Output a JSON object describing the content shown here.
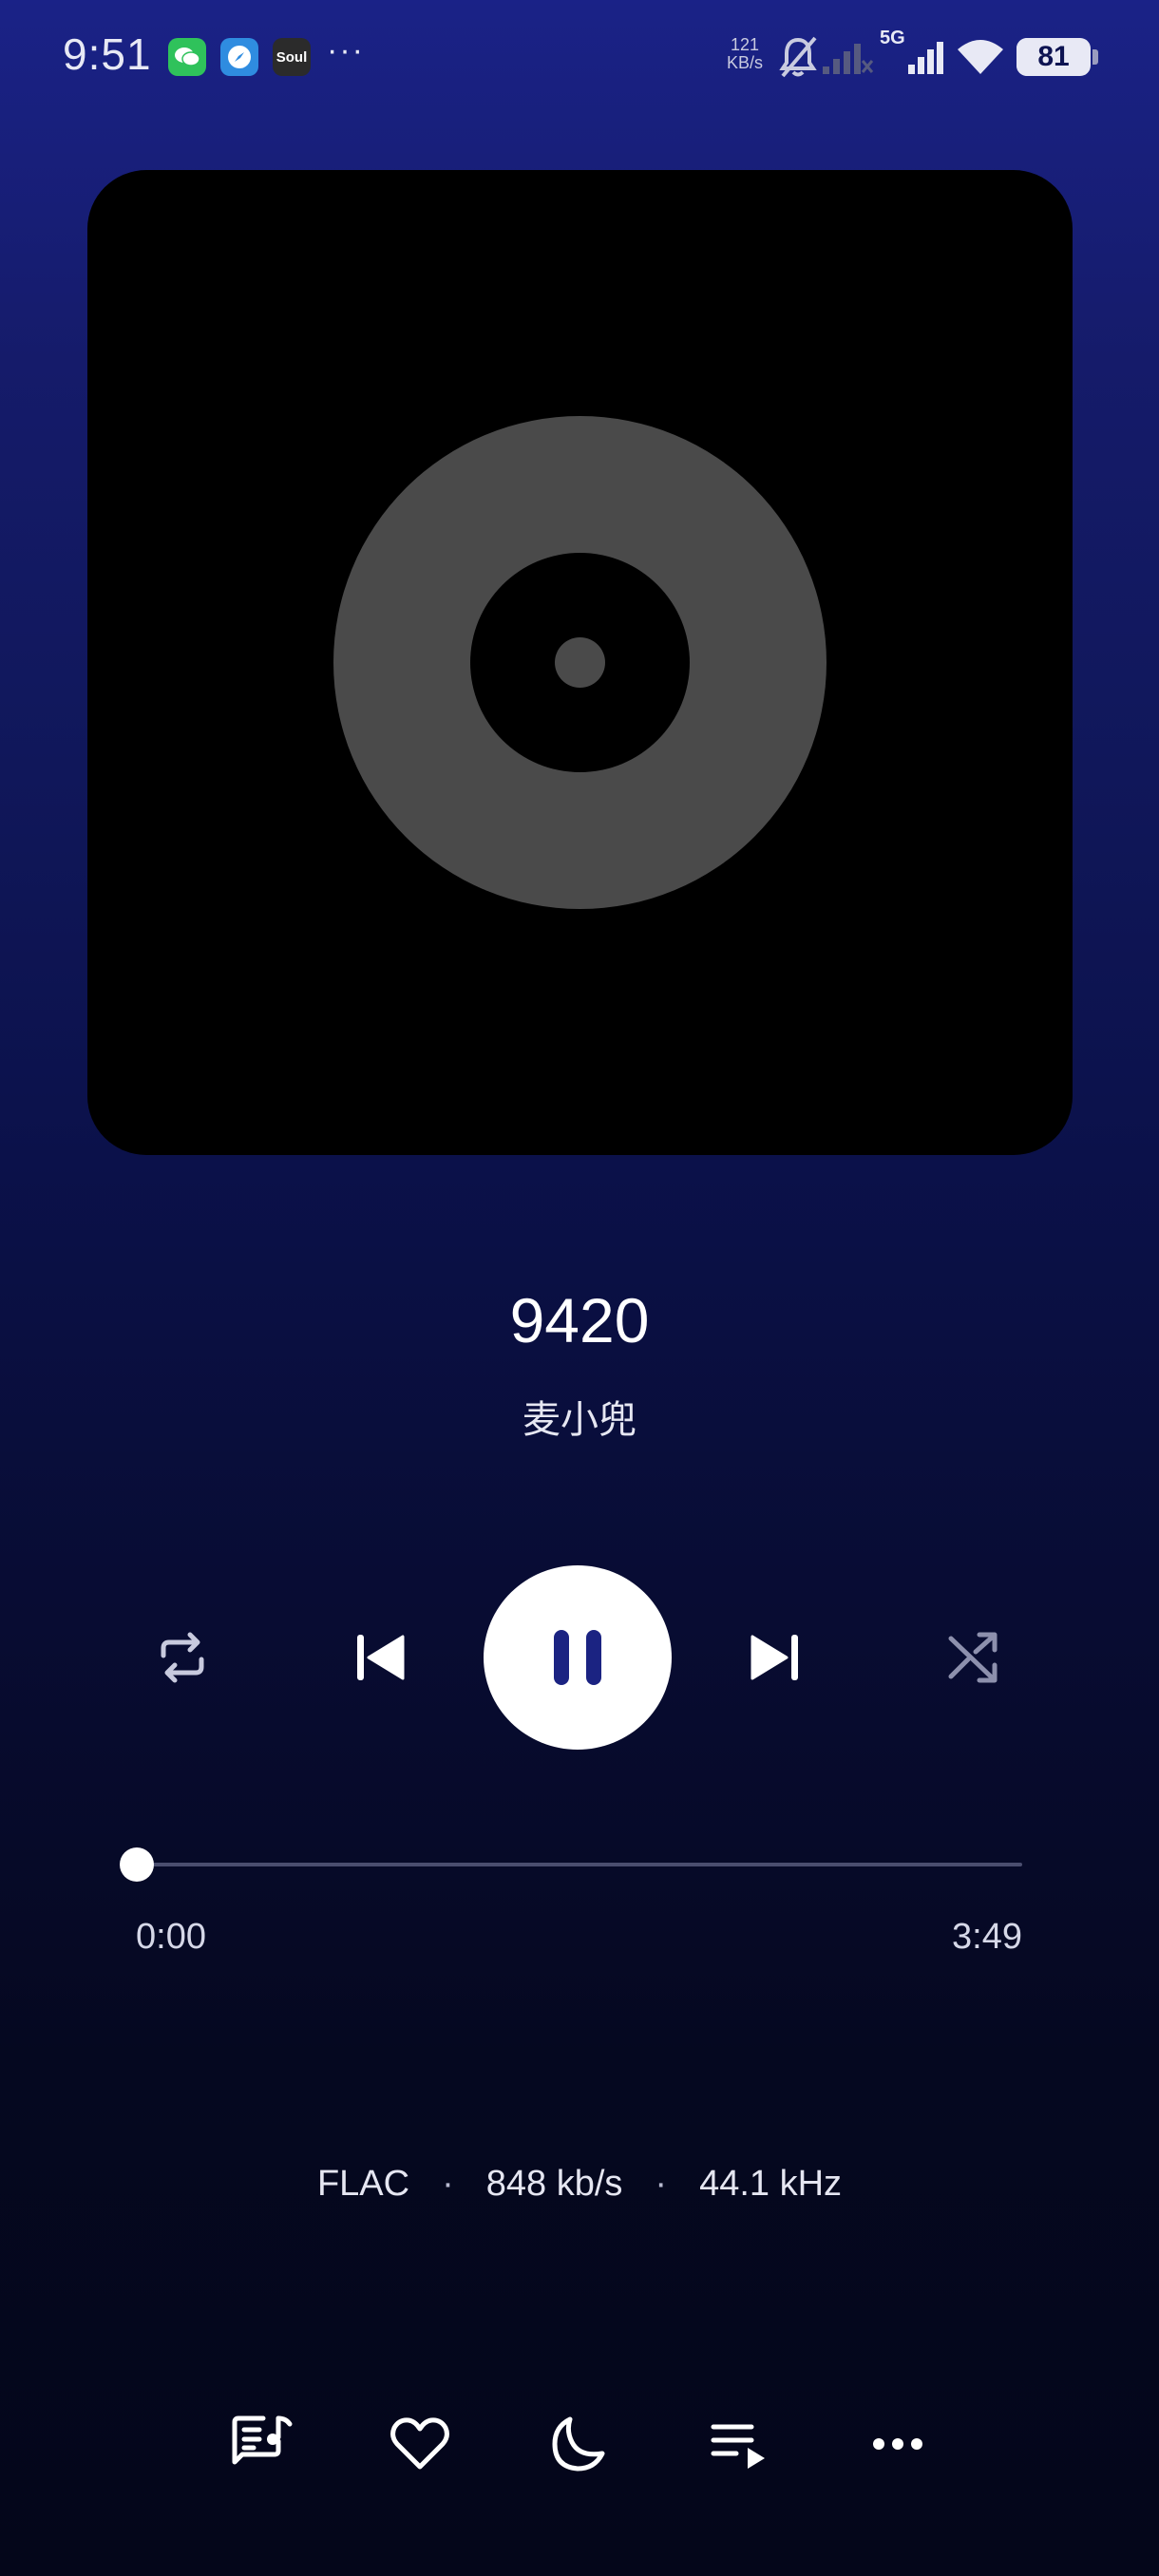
{
  "status_bar": {
    "time": "9:51",
    "apps": [
      {
        "name": "wechat-icon"
      },
      {
        "name": "browser-icon"
      },
      {
        "name": "soul-icon",
        "label": "Soul"
      }
    ],
    "more": "···",
    "net_speed_value": "121",
    "net_speed_unit": "KB/s",
    "network": "5G",
    "battery": "81",
    "battery_level": 0.81
  },
  "artwork": {
    "placeholder_icon": "vinyl-disc-icon"
  },
  "track": {
    "title": "9420",
    "artist": "麦小兜"
  },
  "controls": {
    "repeat": "repeat-icon",
    "previous": "skip-previous-icon",
    "play_state": "pause-icon",
    "next": "skip-next-icon",
    "shuffle": "shuffle-icon"
  },
  "progress": {
    "current": "0:00",
    "total": "3:49",
    "fraction": 0.0
  },
  "audio_info": {
    "format": "FLAC",
    "bitrate": "848 kb/s",
    "sample_rate": "44.1 kHz",
    "separator": "·"
  },
  "bottom_bar": [
    {
      "name": "lyrics-icon"
    },
    {
      "name": "heart-icon"
    },
    {
      "name": "moon-icon"
    },
    {
      "name": "queue-icon"
    },
    {
      "name": "more-icon"
    }
  ],
  "colors": {
    "accent": "#1a237e",
    "primary_text": "#ffffff",
    "disc": "#4a4a4a"
  }
}
